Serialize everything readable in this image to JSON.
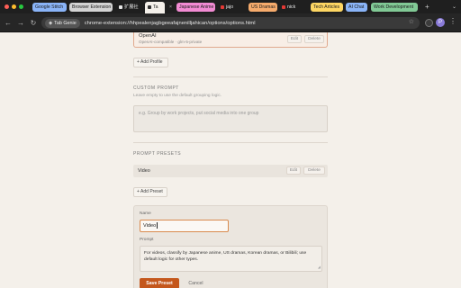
{
  "browser": {
    "tabs": [
      {
        "label": "Google Stitch",
        "bg": "#8ab4f8"
      },
      {
        "label": "Browser Extension",
        "bg": "#d4d4d4"
      },
      {
        "label": "扩展社",
        "bg": ""
      },
      {
        "label": "Ta",
        "bg": "active"
      },
      {
        "label": "Japanese Anime",
        "bg": "#f28bd3"
      },
      {
        "label": "jajo",
        "bg": ""
      },
      {
        "label": "US Dramas",
        "bg": "#f6ab6c"
      },
      {
        "label": "nick",
        "bg": ""
      },
      {
        "label": "Tech Articles",
        "bg": "#fdd663"
      },
      {
        "label": "AI Chat",
        "bg": "#8ab4f8"
      },
      {
        "label": "Work Development",
        "bg": "#81c995"
      }
    ],
    "site_chip": "Tab Genie",
    "url": "chrome-extension://hhpealenjagbgeeafajnenilljahican/options/options.html",
    "avatar_letter": "P"
  },
  "provider": {
    "name": "OpenAI",
    "subtitle": "OpenAI-compatible · glm-5-private",
    "edit_label": "Edit",
    "delete_label": "Delete",
    "add_profile_label": "+ Add Profile"
  },
  "custom_prompt": {
    "title": "CUSTOM PROMPT",
    "hint": "Leave empty to use the default grouping logic.",
    "placeholder": "e.g. Group by work projects, put social media into one group"
  },
  "prompt_presets": {
    "title": "PROMPT PRESETS",
    "items": [
      {
        "name": "Video",
        "edit_label": "Edit",
        "delete_label": "Delete"
      }
    ],
    "add_preset_label": "+ Add Preset"
  },
  "editor": {
    "name_label": "Name",
    "name_value": "Video",
    "prompt_label": "Prompt",
    "prompt_value": "For videos, classify by Japanese anime, US dramas, Korean dramas, or Bilibili; use default logic for other types.",
    "save_label": "Save Preset",
    "cancel_label": "Cancel"
  },
  "colors": {
    "accent": "#c4571c",
    "page_bg": "#f4f0ea",
    "active_border": "#d98a4e"
  }
}
